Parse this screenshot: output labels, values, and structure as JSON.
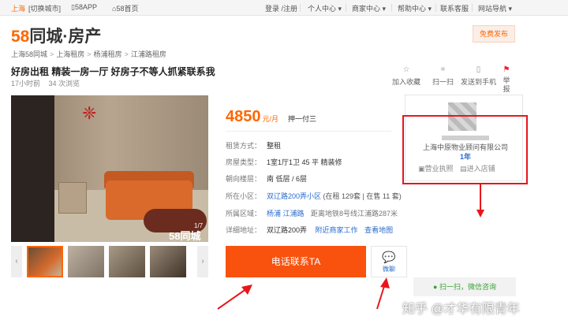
{
  "topbar": {
    "city": "上海",
    "switch_city": "[切换城市]",
    "app": "58APP",
    "home": "58首页",
    "login": "登录 /注册",
    "personal": "个人中心",
    "merchant": "商家中心",
    "help": "帮助中心",
    "contact": "联系客服",
    "nav": "网站导航"
  },
  "logo": {
    "number": "58",
    "text": "同城·房产"
  },
  "post_button": "免费发布",
  "breadcrumb": [
    "上海58同城",
    "上海租房",
    "杨浦租房",
    "江浦路租房"
  ],
  "breadcrumb_sep": ">",
  "listing": {
    "title": "好房出租 精装一房一厅 好房子不等人抓紧联系我",
    "posted": "17小时前",
    "views": "34 次浏览"
  },
  "tools": {
    "favorite": "加入收藏",
    "scan": "扫一扫",
    "send_phone": "发送到手机",
    "report": "举报"
  },
  "photo": {
    "watermark": "58同城",
    "page": "1/7"
  },
  "price": {
    "amount": "4850",
    "unit": "元/月",
    "payment": "押一付三"
  },
  "details": [
    {
      "key": "租赁方式：",
      "value": "整租"
    },
    {
      "key": "房屋类型：",
      "value": "1室1厅1卫  45 平  精装修"
    },
    {
      "key": "朝向楼层：",
      "value": "南  低层 / 6层"
    },
    {
      "key": "所在小区：",
      "value": "双辽路200弄小区",
      "extra": "(在租 129套 | 在售 11 套)"
    },
    {
      "key": "所属区域：",
      "value": "杨浦  江浦路",
      "extra": "距离地铁8号线江浦路287米"
    },
    {
      "key": "详细地址：",
      "value": "双辽路200弄",
      "link1": "附近商家工作",
      "link2": "查看地图"
    }
  ],
  "agent": {
    "company": "上海中原物业顾问有限公司",
    "years": "1年",
    "license": "营业执照",
    "enter_shop": "进入店铺"
  },
  "phone_button": "电话联系TA",
  "chat_button": "微聊",
  "wechat": "扫一扫，微信咨询",
  "watermark_text": "知乎 @才华有限青年"
}
